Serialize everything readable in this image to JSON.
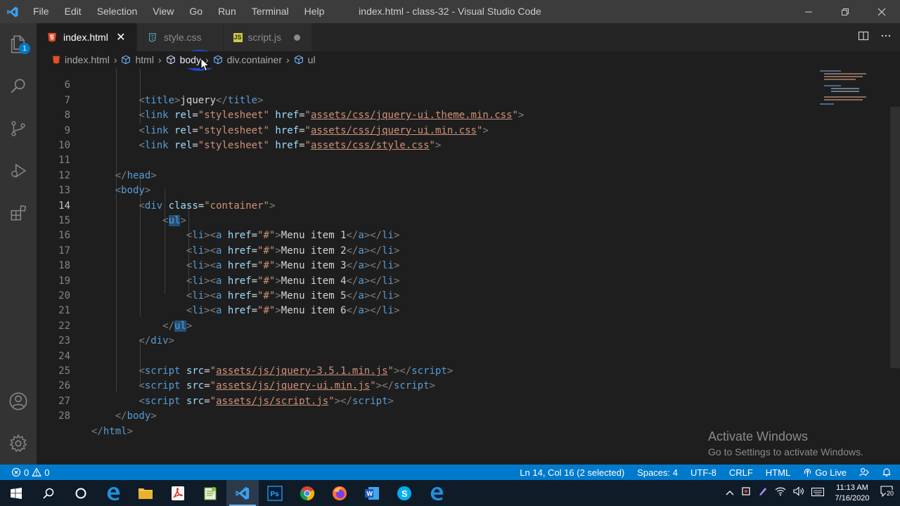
{
  "titlebar": {
    "menu": [
      "File",
      "Edit",
      "Selection",
      "View",
      "Go",
      "Run",
      "Terminal",
      "Help"
    ],
    "title": "index.html - class-32 - Visual Studio Code"
  },
  "activity": {
    "explorer_badge": "1"
  },
  "tabs": [
    {
      "label": "index.html",
      "icon": "html5-icon",
      "active": true
    },
    {
      "label": "style.css",
      "icon": "css-icon",
      "active": false
    },
    {
      "label": "script.js",
      "icon": "js-icon",
      "active": false,
      "modified": true
    }
  ],
  "breadcrumb": [
    "index.html",
    "html",
    "body",
    "div.container",
    "ul"
  ],
  "editor": {
    "lines": [
      {
        "n": "6",
        "indent": 2
      },
      {
        "n": "7",
        "indent": 2
      },
      {
        "n": "8",
        "indent": 2
      },
      {
        "n": "9",
        "indent": 2
      },
      {
        "n": "10"
      },
      {
        "n": "11"
      },
      {
        "n": "12"
      },
      {
        "n": "13"
      },
      {
        "n": "14"
      },
      {
        "n": "15"
      },
      {
        "n": "16"
      },
      {
        "n": "17"
      },
      {
        "n": "18"
      },
      {
        "n": "19"
      },
      {
        "n": "20"
      },
      {
        "n": "21"
      },
      {
        "n": "22"
      },
      {
        "n": "23"
      },
      {
        "n": "24"
      },
      {
        "n": "25"
      },
      {
        "n": "26"
      },
      {
        "n": "27"
      },
      {
        "n": "28"
      }
    ],
    "title_text": "jquery",
    "head_links": [
      "assets/css/jquery-ui.theme.min.css",
      "assets/css/jquery-ui.min.css",
      "assets/css/style.css"
    ],
    "container_class": "container",
    "menu_items": [
      "Menu item 1",
      "Menu item 2",
      "Menu item 3",
      "Menu item 4",
      "Menu item 5",
      "Menu item 6"
    ],
    "scripts": [
      "assets/js/jquery-3.5.1.min.js",
      "assets/js/jquery-ui.min.js",
      "assets/js/script.js"
    ]
  },
  "watermark": {
    "line1": "Activate Windows",
    "line2": "Go to Settings to activate Windows."
  },
  "statusbar": {
    "errors": "0",
    "warnings": "0",
    "position": "Ln 14, Col 16 (2 selected)",
    "spaces": "Spaces: 4",
    "encoding": "UTF-8",
    "eol": "CRLF",
    "language": "HTML",
    "golive": "Go Live"
  },
  "taskbar": {
    "time": "11:13 AM",
    "date": "7/16/2020",
    "notif_count": "20"
  },
  "colors": {
    "accent": "#007acc",
    "tag": "#569cd6",
    "attr": "#9cdcfe",
    "string": "#ce9178"
  }
}
